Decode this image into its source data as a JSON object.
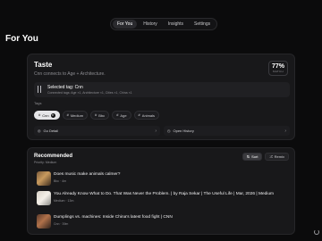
{
  "nav": {
    "tabs": [
      "For You",
      "History",
      "Insights",
      "Settings"
    ],
    "active": 0
  },
  "page_title": "For You",
  "taste": {
    "title": "Taste",
    "subtitle": "Cnn connects to Age + Architecture.",
    "match_value": "77%",
    "match_label": "MATCH",
    "selected_title": "Selected tag: Cnn",
    "selected_sub": "Connected tags: Age ×1, Architecture ×1, Cities ×1, China ×1",
    "tags_label": "Tags",
    "tags": [
      "Cnn",
      "Medium",
      "Bbc",
      "Age",
      "Animals"
    ],
    "actions": [
      "Go Detail",
      "Open History"
    ]
  },
  "recommended": {
    "title": "Recommended",
    "subtitle": "Priority: Medium",
    "controls": [
      "Sort",
      "Remix"
    ],
    "items": [
      {
        "title": "Does music make animals calmer?",
        "meta": "Bbc · 4m"
      },
      {
        "title": "You Already Know What to Do. That Was Never the Problem. | by Raja Sekar | The Useful Life | Mar, 2026 | Medium",
        "meta": "Medium · 13m"
      },
      {
        "title": "Dumplings vs. machines: Inside China's latest food fight | CNN",
        "meta": "Cnn · 39m"
      }
    ]
  },
  "colors": {
    "background": "#0b0b0c",
    "card": "#18181a",
    "accent": "#e6e6e8"
  }
}
